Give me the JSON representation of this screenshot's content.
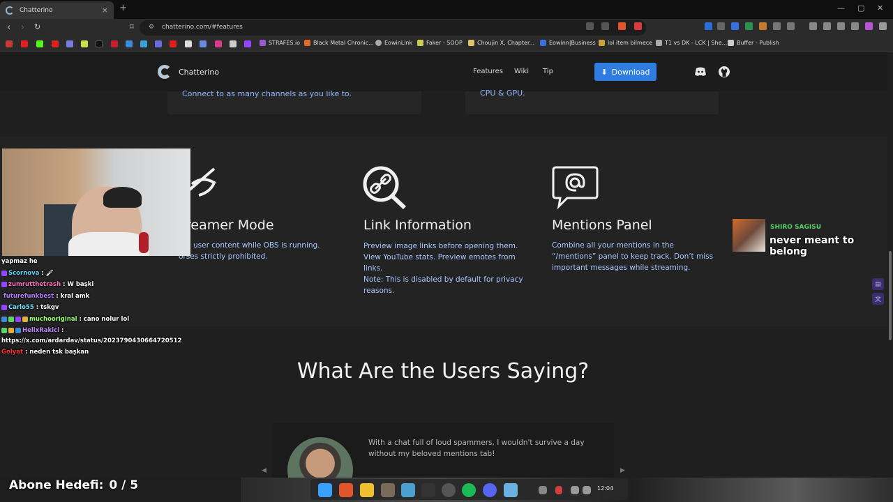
{
  "browser": {
    "tab_title": "Chatterino",
    "tab_close": "×",
    "new_tab": "+",
    "window_controls": [
      "—",
      "▢",
      "✕"
    ],
    "url": "chatterino.com/#features"
  },
  "bookmarks": [
    "STRAFES.io",
    "Black Metal Chronic...",
    "EowinLink",
    "Faker - SOOP",
    "Choujin X, Chapter...",
    "Eowinn|Business",
    "lol item bilmece",
    "T1 vs DK - LCK | She...",
    "Buffer - Publish"
  ],
  "site": {
    "brand": "Chatterino",
    "nav": [
      "Features",
      "Wiki",
      "Tip"
    ],
    "download": "Download"
  },
  "cards": {
    "left": "Connect to as many channels as you like to.",
    "right": "CPU & GPU."
  },
  "features": [
    {
      "title": "reamer Mode",
      "lines": [
        "user content while OBS is running.",
        "orses strictly prohibited."
      ]
    },
    {
      "title": "Link Information",
      "lines": [
        "Preview image links before opening them.",
        "View YouTube stats. Preview emotes from",
        "links.",
        "Note: This is disabled by default for privacy",
        "reasons."
      ]
    },
    {
      "title": "Mentions Panel",
      "lines": [
        "Combine all your mentions in the",
        "“/mentions” panel to keep track. Don’t miss",
        "important messages while streaming."
      ]
    }
  ],
  "users_section": {
    "title": "What Are the Users Saying?",
    "quote_line1": "With a chat full of loud spammers, I wouldn't survive a day",
    "quote_line2": "without my beloved mentions tab!"
  },
  "chat": [
    {
      "user": "",
      "msg": "yapmaz he",
      "color": "#ffffff"
    },
    {
      "user": "Scornova",
      "msg": ": 🖌",
      "color": "#5fd3ff"
    },
    {
      "user": "zumrutthetrash",
      "msg": ": W başki",
      "color": "#ff6fbf"
    },
    {
      "user": "futurefunkbest",
      "msg": ": kral amk",
      "color": "#b57bff"
    },
    {
      "user": "Carlo55",
      "msg": ": tskgv",
      "color": "#6fe0ff"
    },
    {
      "user": "muchooriginal",
      "msg": ": cano nolur lol",
      "color": "#9bff6a"
    },
    {
      "user": "HelixRakici",
      "msg": ":",
      "color": "#c48bff"
    },
    {
      "user": "",
      "msg": "https://x.com/ardardav/status/2023790430664720512",
      "color": "#ffffff"
    },
    {
      "user": "Golyat",
      "msg": ": neden tsk başkan",
      "color": "#ff3030"
    }
  ],
  "now_playing": {
    "artist": "SHIRO SAGISU",
    "title": "never meant to belong"
  },
  "goal": {
    "label": "Abone Hedefi:",
    "count": "0 / 5"
  },
  "clock": "12:04",
  "colors": {
    "accent": "#2f7de1",
    "link_text": "#a9c8ff",
    "artist": "#57d06a"
  }
}
